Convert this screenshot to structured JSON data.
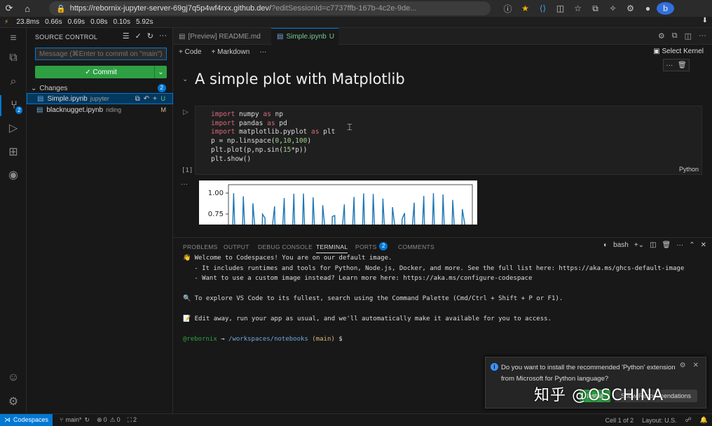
{
  "browser": {
    "url_host": "https://rebornix-jupyter-server-69gj7q5p4wf4rxx.github.dev/",
    "url_rest": "?editSessionId=c7737ffb-167b-4c2e-9de...",
    "icons": [
      "refresh-icon",
      "home-icon",
      "lock-icon",
      "star-icon",
      "profile-icon",
      "bing-icon"
    ]
  },
  "perf": {
    "items": [
      "23.8ms",
      "0.66s",
      "0.69s",
      "0.08s",
      "0.10s",
      "5.92s"
    ],
    "prefix": "⚡"
  },
  "scm": {
    "title": "SOURCE CONTROL",
    "message_placeholder": "Message (⌘Enter to commit on \"main\")",
    "commit_label": "✓ Commit",
    "changes_label": "Changes",
    "changes_count": "2",
    "files": [
      {
        "name": "Simple.ipynb",
        "desc": "jupyter",
        "status": "U"
      },
      {
        "name": "blacknugget.ipynb",
        "desc": "riding",
        "status": "M"
      }
    ],
    "activity_badge": "2"
  },
  "tabs": [
    {
      "label": "[Preview] README.md"
    },
    {
      "label": "Simple.ipynb",
      "suffix": "U"
    }
  ],
  "notebook": {
    "add_code": "+ Code",
    "add_markdown": "+ Markdown",
    "more": "···",
    "kernel": "Select Kernel",
    "heading": "A simple plot with Matplotlib",
    "exec_count": "[1]",
    "language": "Python",
    "plot_yticks": [
      "1.00",
      "0.75"
    ]
  },
  "panel": {
    "tabs": [
      "PROBLEMS",
      "OUTPUT",
      "DEBUG CONSOLE",
      "TERMINAL",
      "PORTS",
      "COMMENTS"
    ],
    "ports_count": "2",
    "shell": "bash"
  },
  "terminal": {
    "line1": "Welcome to Codespaces! You are on our default image.",
    "line2": "   - It includes runtimes and tools for Python, Node.js, Docker, and more. See the full list here: https://aka.ms/ghcs-default-image",
    "line3": "   - Want to use a custom image instead? Learn more here: https://aka.ms/configure-codespace",
    "line4": "To explore VS Code to its fullest, search using the Command Palette (Cmd/Ctrl + Shift + P or F1).",
    "line5": "Edit away, run your app as usual, and we'll automatically make it available for you to access.",
    "prompt_user": "@rebornix",
    "prompt_arrow": "→",
    "prompt_path": "/workspaces/notebooks",
    "prompt_branch": "(main)",
    "prompt_sign": "$"
  },
  "notification": {
    "text": "Do you want to install the recommended 'Python' extension from Microsoft for Python language?",
    "install": "Install",
    "show": "Show Recommendations"
  },
  "watermark": "知乎 @OSCHINA",
  "status": {
    "remote": "Codespaces",
    "branch": "main*",
    "errors": "0",
    "warnings": "0",
    "ports": "2",
    "cell": "Cell 1 of 2",
    "layout": "Layout: U.S."
  }
}
